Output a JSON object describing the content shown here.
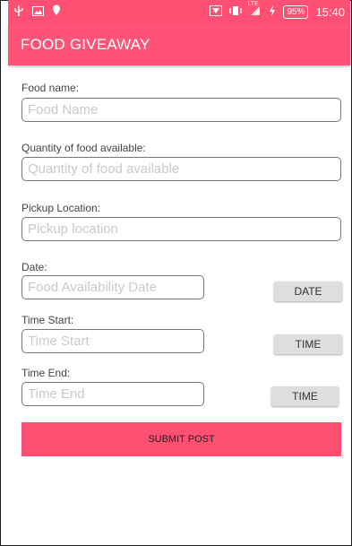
{
  "status_bar": {
    "left_icons": [
      "usb-icon",
      "photo-icon",
      "location-icon"
    ],
    "right_icons": [
      "wifi-icon",
      "vibrate-icon",
      "signal-icon",
      "charging-icon"
    ],
    "network_label": "LTE",
    "battery_percent": "95%",
    "time": "15:40"
  },
  "toolbar": {
    "title": "FOOD GIVEAWAY"
  },
  "form": {
    "food_name": {
      "label": "Food name:",
      "placeholder": "Food Name"
    },
    "quantity": {
      "label": "Quantity of food available:",
      "placeholder": "Quantity of food available"
    },
    "pickup_location": {
      "label": "Pickup Location:",
      "placeholder": "Pickup location"
    },
    "date": {
      "label": "Date:",
      "placeholder": "Food Availability Date",
      "button_label": "DATE"
    },
    "time_start": {
      "label": "Time Start:",
      "placeholder": "Time Start",
      "button_label": "TIME"
    },
    "time_end": {
      "label": "Time End:",
      "placeholder": "Time End",
      "button_label": "TIME"
    },
    "submit_label": "SUBMIT POST"
  },
  "colors": {
    "accent": "#ff4f73",
    "button_gray": "#dedede"
  }
}
